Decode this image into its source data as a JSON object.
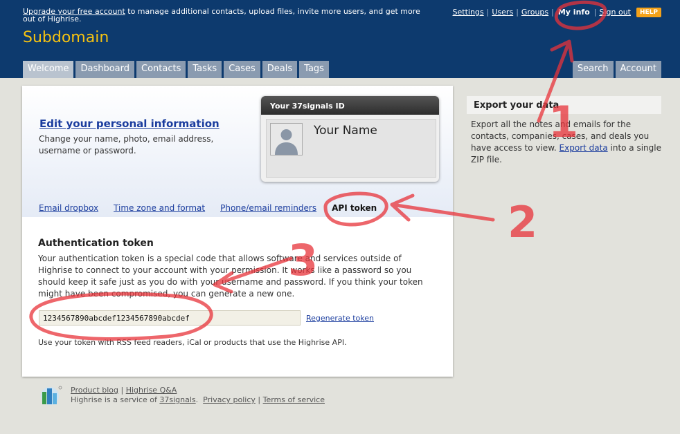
{
  "header": {
    "upgrade_link": "Upgrade your free account",
    "upgrade_rest": "to manage additional contacts, upload files, invite more users, and get more out of Highrise.",
    "site_title": "Subdomain",
    "links": {
      "settings": "Settings",
      "users": "Users",
      "groups": "Groups",
      "my_info": "My info",
      "sign_out": "Sign out",
      "help": "HELP"
    },
    "tabs": [
      "Welcome",
      "Dashboard",
      "Contacts",
      "Tasks",
      "Cases",
      "Deals",
      "Tags"
    ],
    "tabs_right": [
      "Search",
      "Account"
    ]
  },
  "profile": {
    "edit_link": "Edit your personal information",
    "edit_desc": "Change your name, photo, email address, username or password.",
    "id_card_title": "Your 37signals ID",
    "name": "Your Name"
  },
  "subtabs": {
    "email_dropbox": "Email dropbox",
    "time_zone": "Time zone and format",
    "reminders": "Phone/email reminders",
    "api_token": "API token"
  },
  "auth": {
    "title": "Authentication token",
    "description": "Your authentication token is a special code that allows software and services outside of Highrise to connect to your account with your permission. It works like a password so you should keep it safe just as you do with your username and password. If you think your token might have been compromised, you can generate a new one.",
    "token": "1234567890abcdef1234567890abcdef",
    "regenerate": "Regenerate token",
    "usage": "Use your token with RSS feed readers, iCal or products that use the Highrise API."
  },
  "sidebar": {
    "title": "Export your data",
    "desc_before": "Export all the notes and emails for the contacts, companies, cases, and deals you have access to view.",
    "link": "Export data",
    "desc_after": "into a single ZIP file."
  },
  "footer": {
    "product_blog": "Product blog",
    "qa": "Highrise Q&A",
    "service_text": "Highrise is a service of",
    "signals": "37signals",
    "privacy": "Privacy policy",
    "terms": "Terms of service"
  },
  "annotations": {
    "n1": "1",
    "n2": "2",
    "n3": "3"
  },
  "colors": {
    "header_bg": "#0d3a6e",
    "title_yellow": "#f5c211",
    "annotation_red": "#e8333a",
    "help_orange": "#f4a21a"
  }
}
